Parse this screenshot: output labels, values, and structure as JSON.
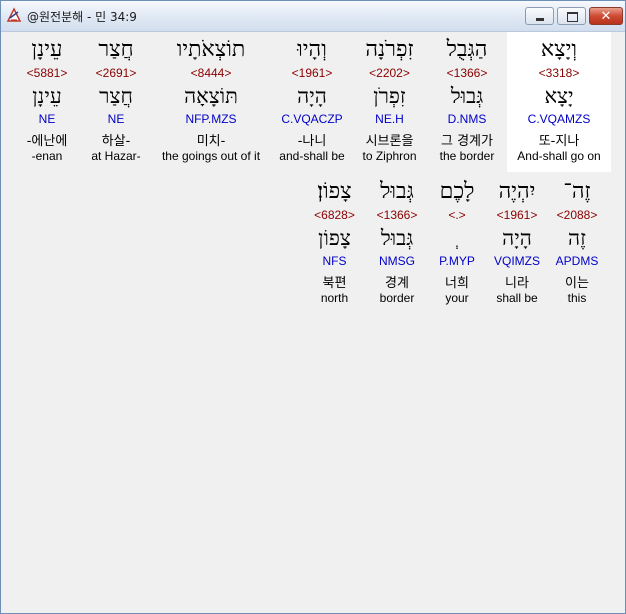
{
  "window": {
    "title": "@원전분해 - 민 34:9",
    "minimize_label": "",
    "maximize_label": "",
    "close_label": "✕"
  },
  "row1": [
    {
      "hebrew": "וְיָצָא",
      "strong": "<3318>",
      "lexeme": "יָצָא",
      "morph": "C.VQAMZS",
      "korean": "또-지나",
      "english": "And-shall go on",
      "highlighted": true
    },
    {
      "hebrew": "הַגְּבֻל",
      "strong": "<1366>",
      "lexeme": "גְּבוּל",
      "morph": "D.NMS",
      "korean": "그 경계가",
      "english": "the border",
      "highlighted": false
    },
    {
      "hebrew": "זִפְרֹנָה",
      "strong": "<2202>",
      "lexeme": "זִפְרֹן",
      "morph": "NE.H",
      "korean": "시브론을",
      "english": "to Ziphron",
      "highlighted": false
    },
    {
      "hebrew": "וְהָיוּ",
      "strong": "<1961>",
      "lexeme": "הָיָה",
      "morph": "C.VQACZP",
      "korean": "-나니",
      "english": "and-shall be",
      "highlighted": false
    },
    {
      "hebrew": "תוֹצְאֹתָיו",
      "strong": "<8444>",
      "lexeme": "תּוֹצָאָה",
      "morph": "NFP.MZS",
      "korean": "미치-",
      "english": "the goings out of it",
      "highlighted": false
    },
    {
      "hebrew": "חֲצַר",
      "strong": "<2691>",
      "lexeme": "חֲצַר",
      "morph": "NE",
      "korean": "하살-",
      "english": "at Hazar-",
      "highlighted": false
    },
    {
      "hebrew": "עֵינָן",
      "strong": "<5881>",
      "lexeme": "עֵינָן",
      "morph": "NE",
      "korean": "-에난에",
      "english": "-enan",
      "highlighted": false
    }
  ],
  "row2": [
    {
      "hebrew": "זֶה־",
      "strong": "<2088>",
      "lexeme": "זֶה",
      "morph": "APDMS",
      "korean": "이는",
      "english": "this"
    },
    {
      "hebrew": "יִהְיֶה",
      "strong": "<1961>",
      "lexeme": "הָיָה",
      "morph": "VQIMZS",
      "korean": "니라",
      "english": "shall be"
    },
    {
      "hebrew": "לָכֶם",
      "strong": "<.>",
      "lexeme": "ְ",
      "morph": "P.MYP",
      "korean": "너희",
      "english": "your"
    },
    {
      "hebrew": "גְּבוּל",
      "strong": "<1366>",
      "lexeme": "גְּבוּל",
      "morph": "NMSG",
      "korean": "경계",
      "english": "border"
    },
    {
      "hebrew": "צָפוֹן׃",
      "strong": "<6828>",
      "lexeme": "צָפוֹן",
      "morph": "NFS",
      "korean": "북편",
      "english": "north"
    }
  ]
}
